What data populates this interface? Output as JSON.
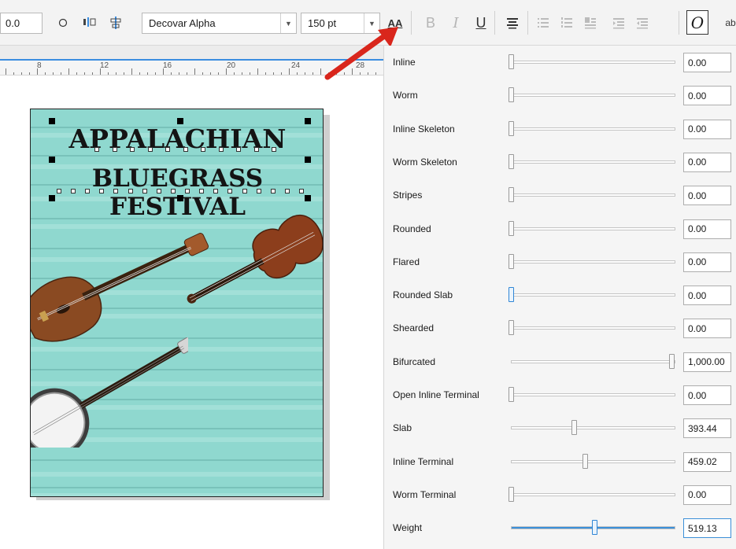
{
  "toolbar": {
    "position_value": "0.0",
    "font_family": "Decovar Alpha",
    "font_size": "150 pt",
    "variable_font_button": "AA",
    "bold_label": "B",
    "italic_label": "I",
    "underline_label": "U",
    "italic_style_label": "O",
    "overflow_label": "ab"
  },
  "ruler": {
    "labels": [
      "8",
      "12",
      "16",
      "20",
      "24",
      "28"
    ]
  },
  "poster": {
    "title_line1": "APPALACHIAN",
    "title_line2": "BLUEGRASS FESTIVAL",
    "colors": {
      "background": "#8fd8cf",
      "plank": "#6fb9b0"
    }
  },
  "panel": {
    "axes": [
      {
        "label": "Inline",
        "value": "0.00",
        "level": 0
      },
      {
        "label": "Worm",
        "value": "0.00",
        "level": 0
      },
      {
        "label": "Inline Skeleton",
        "value": "0.00",
        "level": 0
      },
      {
        "label": "Worm Skeleton",
        "value": "0.00",
        "level": 0
      },
      {
        "label": "Stripes",
        "value": "0.00",
        "level": 0
      },
      {
        "label": "Rounded",
        "value": "0.00",
        "level": 0
      },
      {
        "label": "Flared",
        "value": "0.00",
        "level": 0
      },
      {
        "label": "Rounded Slab",
        "value": "0.00",
        "level": 0,
        "thumb_active": true
      },
      {
        "label": "Shearded",
        "value": "0.00",
        "level": 0
      },
      {
        "label": "Bifurcated",
        "value": "1,000.00",
        "level": 1
      },
      {
        "label": "Open Inline Terminal",
        "value": "0.00",
        "level": 0
      },
      {
        "label": "Slab",
        "value": "393.44",
        "level": 0.393
      },
      {
        "label": "Inline Terminal",
        "value": "459.02",
        "level": 0.459
      },
      {
        "label": "Worm Terminal",
        "value": "0.00",
        "level": 0
      },
      {
        "label": "Weight",
        "value": "519.13",
        "level": 0.519,
        "focused": true
      }
    ]
  },
  "accent_color": "#3b8fd8",
  "annotation_color": "#d9261c"
}
